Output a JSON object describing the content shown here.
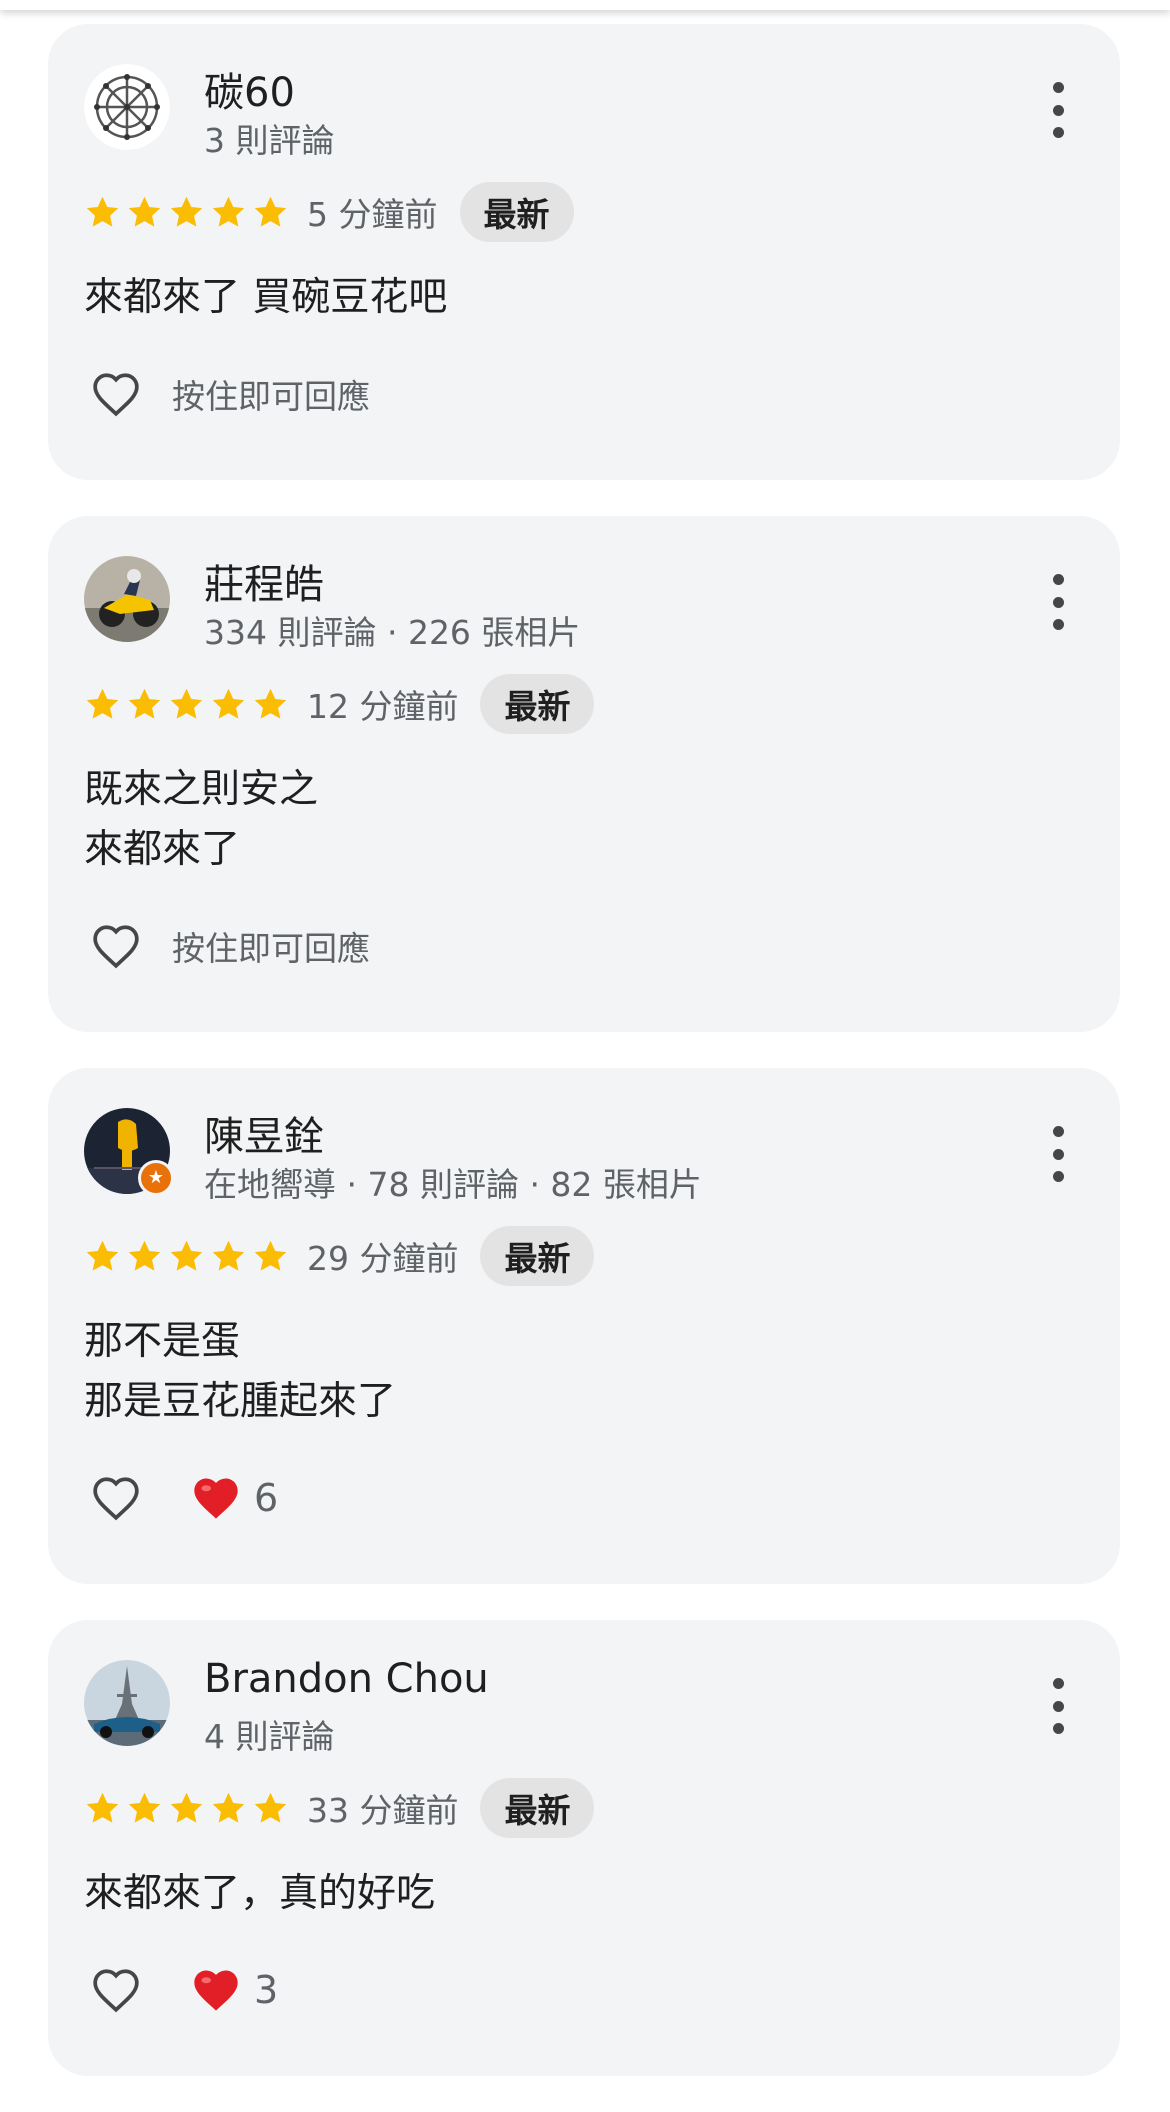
{
  "reviews": [
    {
      "name": "碳60",
      "meta": "3 則評論",
      "stars": 5,
      "time": "5 分鐘前",
      "badge": "最新",
      "text": [
        "來都來了 買碗豆花吧"
      ],
      "action_hint": "按住即可回應",
      "reaction_count": null,
      "avatar": "buckyball-avatar",
      "local_guide": false
    },
    {
      "name": "莊程皓",
      "meta": "334 則評論 · 226 張相片",
      "stars": 5,
      "time": "12 分鐘前",
      "badge": "最新",
      "text": [
        "既來之則安之",
        "來都來了"
      ],
      "action_hint": "按住即可回應",
      "reaction_count": null,
      "avatar": "motorcycle-avatar",
      "local_guide": false
    },
    {
      "name": "陳昱銓",
      "meta": "在地嚮導 · 78 則評論 · 82 張相片",
      "stars": 5,
      "time": "29 分鐘前",
      "badge": "最新",
      "text": [
        "那不是蛋",
        "那是豆花腫起來了"
      ],
      "action_hint": null,
      "reaction_count": "6",
      "avatar": "character-avatar",
      "local_guide": true
    },
    {
      "name": "Brandon Chou",
      "meta": "4 則評論",
      "stars": 5,
      "time": "33 分鐘前",
      "badge": "最新",
      "text": [
        "來都來了，真的好吃"
      ],
      "action_hint": null,
      "reaction_count": "3",
      "avatar": "eiffel-tower-car-avatar",
      "local_guide": false
    }
  ],
  "colors": {
    "card_bg": "#f3f4f6",
    "star": "#fbbc04",
    "badge_bg": "#e3e3e3",
    "heart_red": "#e21f26",
    "meta_text": "#5f6368"
  },
  "icons": {
    "like": "heart-outline-icon",
    "reaction": "red-heart-emoji",
    "more": "more-vert-icon",
    "star": "star-icon",
    "guide": "local-guide-star-icon"
  }
}
